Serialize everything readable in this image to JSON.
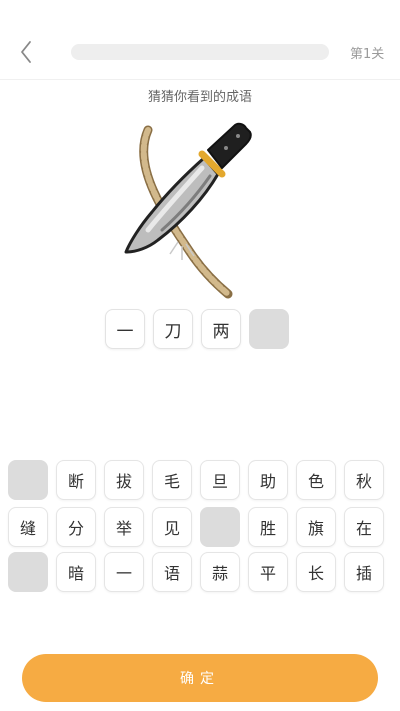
{
  "header": {
    "back_icon": "chevron-left-icon",
    "progress_fraction": 0,
    "level_label": "第1关"
  },
  "prompt": "猜猜你看到的成语",
  "illustration": {
    "description_icon": "knife-cutting-rope-icon",
    "colors": {
      "blade": "#b9b9b9",
      "handle": "#1e1e1e",
      "rope": "#c8ab7e"
    }
  },
  "answer_slots": [
    "一",
    "刀",
    "两",
    ""
  ],
  "choices": [
    [
      "",
      "断",
      "拔",
      "毛",
      "旦",
      "助",
      "色",
      "秋"
    ],
    [
      "缝",
      "分",
      "举",
      "见",
      "",
      "胜",
      "旗",
      "在"
    ],
    [
      "",
      "暗",
      "一",
      "语",
      "蒜",
      "平",
      "长",
      "插"
    ]
  ],
  "confirm_label": "确定",
  "colors": {
    "accent": "#f6ab43",
    "empty_tile": "#dcdcdc"
  }
}
